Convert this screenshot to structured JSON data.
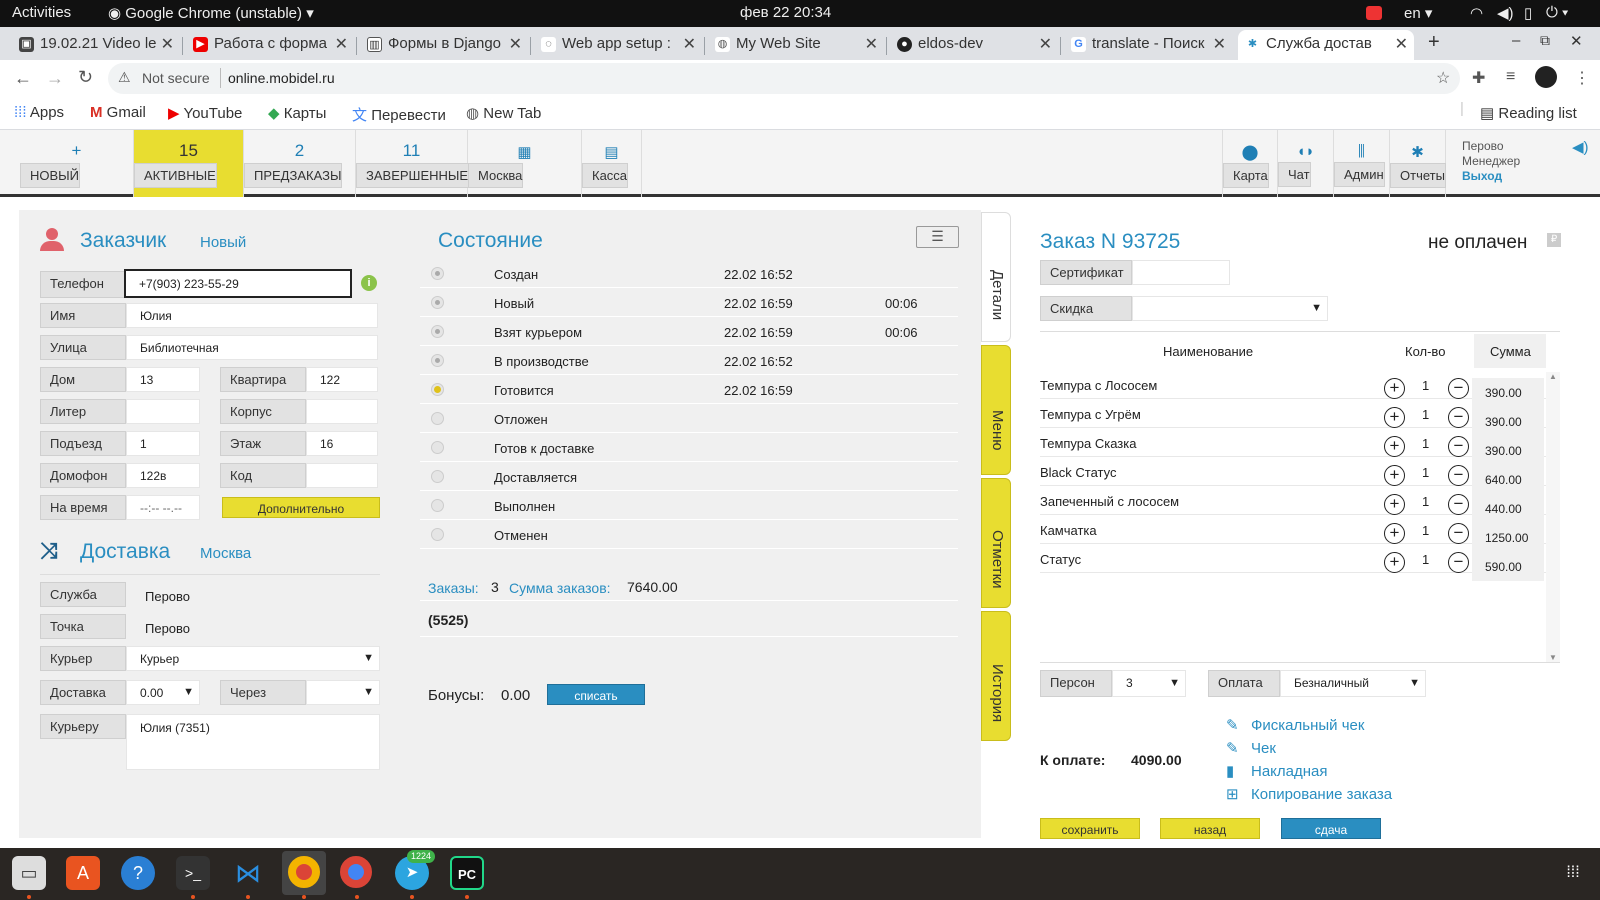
{
  "system": {
    "activities": "Activities",
    "app": "Google Chrome (unstable)",
    "clock": "фев 22  20:34",
    "lang": "en"
  },
  "tabs": [
    {
      "label": "19.02.21 Video le"
    },
    {
      "label": "Работа с форма"
    },
    {
      "label": "Формы в Django"
    },
    {
      "label": "Web app setup :"
    },
    {
      "label": "My Web Site"
    },
    {
      "label": "eldos-dev"
    },
    {
      "label": "translate - Поиск"
    },
    {
      "label": "Служба достав"
    }
  ],
  "address": {
    "security": "Not secure",
    "url": "online.mobidel.ru"
  },
  "bookmarks": [
    "Apps",
    "Gmail",
    "YouTube",
    "Карты",
    "Перевести",
    "New Tab"
  ],
  "reading_list": "Reading list",
  "toolbar": {
    "new": {
      "icon": "+",
      "label": "НОВЫЙ"
    },
    "active": {
      "count": "15",
      "label": "АКТИВНЫЕ"
    },
    "preorders": {
      "count": "2",
      "label": "ПРЕДЗАКАЗЫ"
    },
    "done": {
      "count": "11",
      "label": "ЗАВЕРШЕННЫЕ"
    },
    "city": "Москва",
    "cash": "Касса",
    "map": "Карта",
    "chat": "Чат",
    "admin": "Админ",
    "reports": "Отчеты",
    "user_line1": "Перово",
    "user_line2": "Менеджер",
    "logout": "Выход"
  },
  "customer": {
    "title": "Заказчик",
    "status": "Новый",
    "phone_label": "Телефон",
    "phone": "+7(903) 223-55-29",
    "name_label": "Имя",
    "name": "Юлия",
    "street_label": "Улица",
    "street": "Библиотечная",
    "house_label": "Дом",
    "house": "13",
    "apt_label": "Квартира",
    "apt": "122",
    "liter_label": "Литер",
    "liter": "",
    "korpus_label": "Корпус",
    "korpus": "",
    "entrance_label": "Подъезд",
    "entrance": "1",
    "floor_label": "Этаж",
    "floor": "16",
    "intercom_label": "Домофон",
    "intercom": "122в",
    "code_label": "Код",
    "code": "",
    "time_label": "На время",
    "time": "--:-- --.--",
    "extra_button": "Дополнительно"
  },
  "delivery": {
    "title": "Доставка",
    "city": "Москва",
    "service_label": "Служба",
    "service": "Перово",
    "point_label": "Точка",
    "point": "Перово",
    "courier_label": "Курьер",
    "courier": "Курьер",
    "delivery_label": "Доставка",
    "delivery_value": "0.00",
    "via_label": "Через",
    "via_value": "",
    "to_courier_label": "Курьеру",
    "to_courier": "Юлия (7351)"
  },
  "state": {
    "title": "Состояние",
    "rows": [
      {
        "name": "Создан",
        "time": "22.02 16:52",
        "dur": "",
        "mark": "dot"
      },
      {
        "name": "Новый",
        "time": "22.02 16:59",
        "dur": "00:06",
        "mark": "dot"
      },
      {
        "name": "Взят курьером",
        "time": "22.02 16:59",
        "dur": "00:06",
        "mark": "dot"
      },
      {
        "name": "В производстве",
        "time": "22.02 16:52",
        "dur": "",
        "mark": "dot"
      },
      {
        "name": "Готовится",
        "time": "22.02 16:59",
        "dur": "",
        "mark": "on"
      },
      {
        "name": "Отложен",
        "time": "",
        "dur": "",
        "mark": "empty"
      },
      {
        "name": "Готов к доставке",
        "time": "",
        "dur": "",
        "mark": "empty"
      },
      {
        "name": "Доставляется",
        "time": "",
        "dur": "",
        "mark": "empty"
      },
      {
        "name": "Выполнен",
        "time": "",
        "dur": "",
        "mark": "empty"
      },
      {
        "name": "Отменен",
        "time": "",
        "dur": "",
        "mark": "empty"
      }
    ],
    "orders_label": "Заказы:",
    "orders_count": "3",
    "sum_label": "Сумма заказов:",
    "sum_value": "7640.00",
    "code": "(5525)",
    "bonus_label": "Бонусы:",
    "bonus_value": "0.00",
    "bonus_button": "списать"
  },
  "side_tabs": [
    "Детали",
    "Меню",
    "Отметки",
    "История"
  ],
  "order": {
    "title": "Заказ N 93725",
    "paid_status": "не оплачен",
    "cert_label": "Сертификат",
    "cert_value": "",
    "discount_label": "Скидка",
    "discount_value": "",
    "col_name": "Наименование",
    "col_qty": "Кол-во",
    "col_sum": "Сумма",
    "items": [
      {
        "name": "Темпура с Лососем",
        "qty": "1",
        "sum": "390.00"
      },
      {
        "name": "Темпура с Угрём",
        "qty": "1",
        "sum": "390.00"
      },
      {
        "name": "Темпура Сказка",
        "qty": "1",
        "sum": "390.00"
      },
      {
        "name": "Black Статус",
        "qty": "1",
        "sum": "640.00"
      },
      {
        "name": "Запеченный с лососем",
        "qty": "1",
        "sum": "440.00"
      },
      {
        "name": "Камчатка",
        "qty": "1",
        "sum": "1250.00"
      },
      {
        "name": "Статус",
        "qty": "1",
        "sum": "590.00"
      }
    ],
    "persons_label": "Персон",
    "persons": "3",
    "payment_label": "Оплата",
    "payment": "Безналичный",
    "to_pay_label": "К оплате:",
    "to_pay": "4090.00",
    "links": [
      "Фискальный чек",
      "Чек",
      "Накладная",
      "Копирование заказа"
    ],
    "save": "сохранить",
    "back": "назад",
    "change": "сдача"
  },
  "dock": {
    "telegram_badge": "1224"
  },
  "colors": {
    "accent": "#2a8ec1",
    "yellow": "#e8dd30"
  }
}
